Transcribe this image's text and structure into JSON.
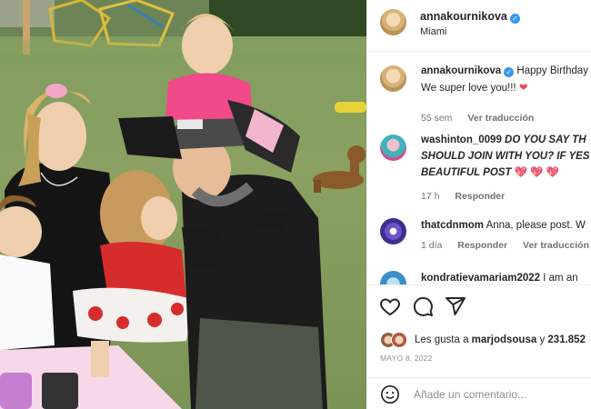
{
  "post": {
    "username": "annakournikova",
    "location": "Miami",
    "caption_text": "Happy Birthday",
    "caption_line2": "We super love you!!!",
    "caption_time": "55 sem",
    "see_translation": "Ver traducción",
    "verified_icon": "verified-badge-icon"
  },
  "comments": [
    {
      "username": "washinton_0099",
      "text_line1": "DO YOU SAY TH",
      "text_line2": "SHOULD JOIN WITH YOU? IF YES",
      "text_line3": "BEAUTIFUL POST",
      "emoji": "💖 💖 💖",
      "time": "17 h",
      "reply": "Responder"
    },
    {
      "username": "thatcdnmom",
      "text": "Anna, please post. W",
      "time": "1 día",
      "reply": "Responder",
      "translate": "Ver traducción"
    },
    {
      "username": "kondratievamariam2022",
      "text": "I am an"
    }
  ],
  "actions": {
    "like_icon": "heart-icon",
    "comment_icon": "comment-icon",
    "share_icon": "send-icon",
    "likes_prefix": "Les gusta a",
    "likes_user": "marjodsousa",
    "likes_and": "y",
    "likes_count": "231.852",
    "date": "MAYO 8, 2022",
    "emoji_icon": "smiley-icon",
    "comment_placeholder": "Añade un comentario..."
  },
  "colors": {
    "verified": "#3897f0",
    "heart": "#ed4956",
    "secondary_text": "#737373",
    "border": "#efefef"
  }
}
